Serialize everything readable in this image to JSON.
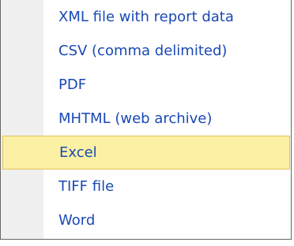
{
  "menu": {
    "items": [
      {
        "label": "XML file with report data"
      },
      {
        "label": "CSV (comma delimited)"
      },
      {
        "label": "PDF"
      },
      {
        "label": "MHTML (web archive)"
      },
      {
        "label": "Excel",
        "selected": true
      },
      {
        "label": "TIFF file"
      },
      {
        "label": "Word"
      }
    ]
  },
  "colors": {
    "item_text": "#1a49b4",
    "highlight_fill": "#fcf0a4",
    "highlight_border": "#e1c35b",
    "gutter": "#f0f0f0",
    "border": "#666666"
  }
}
